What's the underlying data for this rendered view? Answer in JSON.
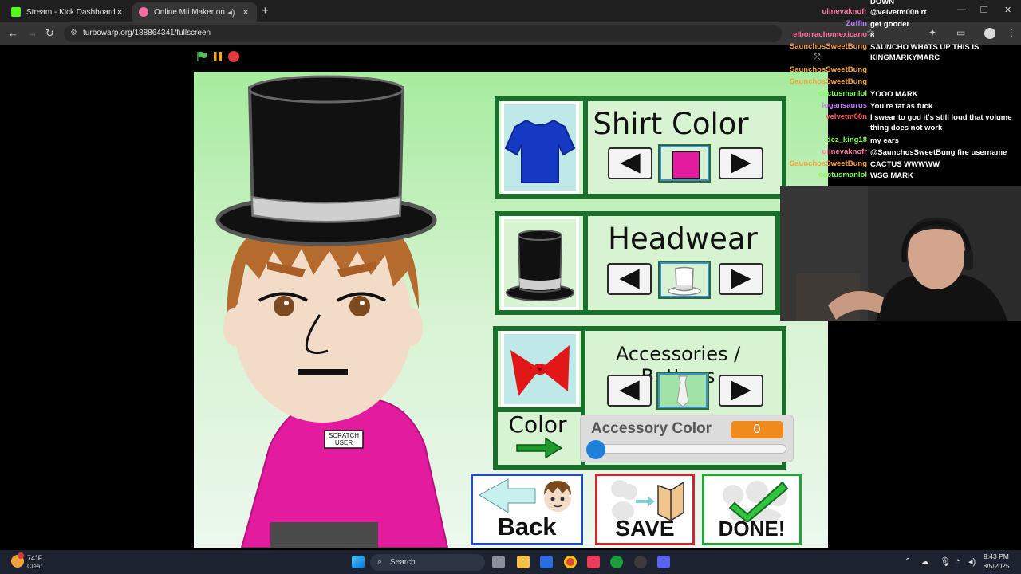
{
  "browser": {
    "tabs": [
      {
        "title": "Stream - Kick Dashboard",
        "favicon_color": "#53fc18"
      },
      {
        "title": "Online Mii Maker on Scratch",
        "favicon_color": "#f26ea3"
      }
    ],
    "url": "turbowarp.org/188864341/fullscreen"
  },
  "editor": {
    "shirt_color": {
      "label": "Shirt Color",
      "swatch_color": "#e31b9e"
    },
    "headwear": {
      "label": "Headwear"
    },
    "accessories": {
      "label": "Accessories / Buttons"
    },
    "color_label": "Color",
    "accessory_color": {
      "label": "Accessory Color",
      "value": "0",
      "fraction": 0.0
    },
    "buttons": {
      "back": "Back",
      "save": "SAVE",
      "done": "DONE!"
    },
    "name_tag": [
      "SCRATCH",
      "USER"
    ]
  },
  "chat": [
    {
      "user": "",
      "message": "DOWN",
      "color": "#ffffff"
    },
    {
      "user": "ulinevaknofr",
      "message": "@velvetm00n rt",
      "color": "#ff7aa8"
    },
    {
      "user": "Zuffin",
      "message": "get gooder",
      "color": "#b97bff"
    },
    {
      "user": "elborrachomexicano",
      "message": "8",
      "color": "#ff6f9c"
    },
    {
      "user": "SaunchosSweetBung",
      "message": "SAUNCHO WHATS UP THIS IS KINGMARKYMARC",
      "color": "#f7a33a"
    },
    {
      "user": "SaunchosSweetBung",
      "message": "",
      "color": "#f7a33a"
    },
    {
      "user": "SaunchosSweetBung",
      "message": "",
      "color": "#f7a33a"
    },
    {
      "user": "cactusmanlol",
      "message": "YOOO MARK",
      "color": "#7fff4f"
    },
    {
      "user": "logansaurus",
      "message": "You're fat as fuck",
      "color": "#c87aff"
    },
    {
      "user": "velvetm00n",
      "message": "I swear to god it's still loud that volume thing does not work",
      "color": "#ff5a5a"
    },
    {
      "user": "dez_king18",
      "message": "my ears",
      "color": "#7fff4f"
    },
    {
      "user": "ulinevaknofr",
      "message": "@SaunchosSweetBung fire username",
      "color": "#ff7aa8"
    },
    {
      "user": "SaunchosSweetBung",
      "message": "CACTUS WWWWW",
      "color": "#f7a33a"
    },
    {
      "user": "cactusmanlol",
      "message": "WSG MARK",
      "color": "#7fff4f"
    }
  ],
  "taskbar": {
    "weather_temp": "74°F",
    "weather_desc": "Clear",
    "search_placeholder": "Search",
    "time": "9:43 PM",
    "date": "8/5/2025"
  }
}
